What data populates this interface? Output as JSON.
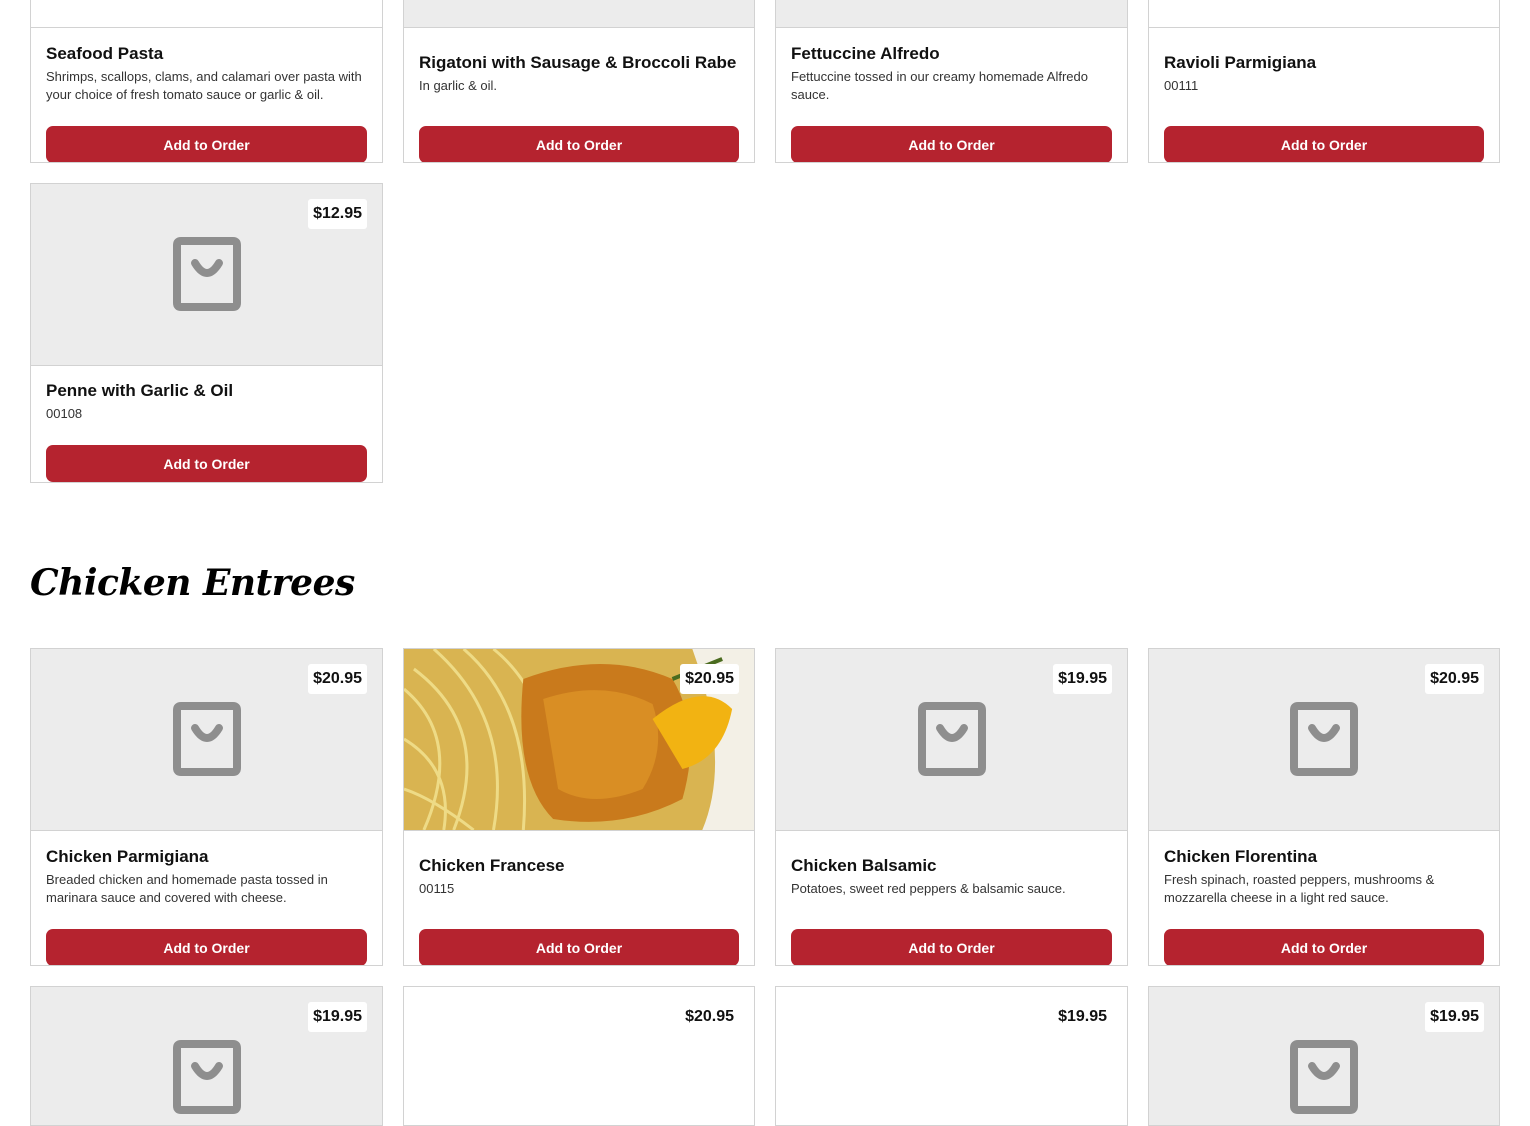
{
  "colors": {
    "accent": "#b5232f",
    "placeholder_bg": "#ececec"
  },
  "icons": {
    "placeholder": "shopping-bag-icon"
  },
  "top_items": [
    {
      "name": "Seafood Pasta",
      "desc": "Shrimps, scallops, clams, and calamari over pasta with your choice of fresh tomato sauce or garlic & oil.",
      "button": "Add to Order"
    },
    {
      "name": "Rigatoni with Sausage & Broccoli Rabe",
      "desc": "In garlic & oil.",
      "button": "Add to Order"
    },
    {
      "name": "Fettuccine Alfredo",
      "desc": "Fettuccine tossed in our creamy homemade Alfredo sauce.",
      "button": "Add to Order"
    },
    {
      "name": "Ravioli Parmigiana",
      "desc": "00111",
      "button": "Add to Order"
    },
    {
      "name": "Penne with Garlic & Oil",
      "price": "$12.95",
      "desc": "00108",
      "button": "Add to Order"
    }
  ],
  "section": {
    "title": "Chicken Entrees"
  },
  "chicken_items": [
    {
      "name": "Chicken Parmigiana",
      "price": "$20.95",
      "desc": "Breaded chicken and homemade pasta tossed in marinara sauce and covered with cheese.",
      "button": "Add to Order"
    },
    {
      "name": "Chicken Francese",
      "price": "$20.95",
      "desc": "00115",
      "button": "Add to Order"
    },
    {
      "name": "Chicken Balsamic",
      "price": "$19.95",
      "desc": "Potatoes, sweet red peppers & balsamic sauce.",
      "button": "Add to Order"
    },
    {
      "name": "Chicken Florentina",
      "price": "$20.95",
      "desc": "Fresh spinach, roasted peppers, mushrooms & mozzarella cheese in a light red sauce.",
      "button": "Add to Order"
    }
  ],
  "next_row_prices": [
    "$19.95",
    "$20.95",
    "$19.95",
    "$19.95"
  ]
}
